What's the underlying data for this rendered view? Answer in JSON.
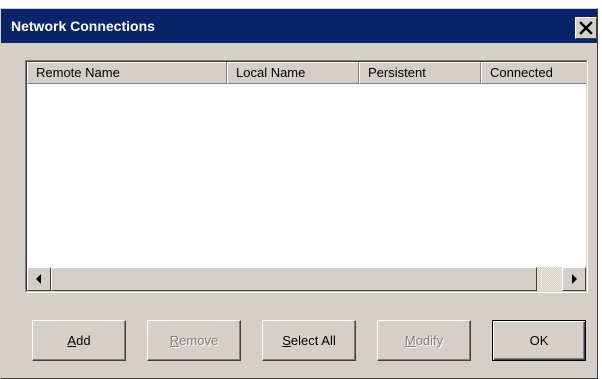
{
  "window": {
    "title": "Network Connections"
  },
  "list": {
    "columns": [
      "Remote Name",
      "Local Name",
      "Persistent",
      "Connected"
    ],
    "rows": []
  },
  "buttons": {
    "add": {
      "accel": "A",
      "rest": "dd",
      "enabled": true
    },
    "remove": {
      "accel": "R",
      "rest": "emove",
      "enabled": false
    },
    "select_all": {
      "accel": "S",
      "rest": "elect All",
      "enabled": true
    },
    "modify": {
      "accel": "M",
      "rest": "odify",
      "enabled": false
    },
    "ok": {
      "label": "OK",
      "enabled": true,
      "default": true
    }
  },
  "icons": {
    "close": "close-icon",
    "scroll_left": "arrow-left-icon",
    "scroll_right": "arrow-right-icon"
  },
  "colors": {
    "titlebar": "#0a246a",
    "face": "#d4d0c8",
    "disabled_text": "#808080"
  }
}
